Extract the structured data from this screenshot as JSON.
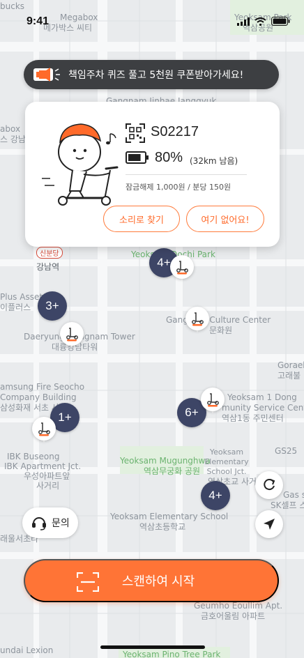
{
  "status_bar": {
    "time": "9:41"
  },
  "map": {
    "labels": [
      {
        "key": "bucks",
        "text": "bucks"
      },
      {
        "key": "megabox1",
        "text": "Megabox"
      },
      {
        "key": "megabox1_kr",
        "text": "메가박스 씨티"
      },
      {
        "key": "yeoksam_park",
        "text": "Yeoksam Park"
      },
      {
        "key": "yeoksam_park_kr",
        "text": "역삼공원"
      },
      {
        "key": "jinhae",
        "text": "Gangnam Jinhae Janggyuk"
      },
      {
        "key": "abox",
        "text": "abox"
      },
      {
        "key": "abox_kr",
        "text": "스 강남"
      },
      {
        "key": "ochi_park",
        "text": "Yeoksam-Dochi Park"
      },
      {
        "key": "gangnam_stn",
        "text": "강남역"
      },
      {
        "key": "plus_asset",
        "text": "Plus Asset"
      },
      {
        "key": "plus_asset_kr",
        "text": "이플러스"
      },
      {
        "key": "culture_center",
        "text": "Gangnam Culture Center"
      },
      {
        "key": "culture_center_kr",
        "text": "문화원"
      },
      {
        "key": "daeryung",
        "text": "Daeryung Gangnam Tower"
      },
      {
        "key": "daeryung_kr",
        "text": "대륭강남타워"
      },
      {
        "key": "goraebal",
        "text": "Goraeb"
      },
      {
        "key": "goraebal_kr",
        "text": "고래불"
      },
      {
        "key": "samsung",
        "text": "amsung Fire Seocho"
      },
      {
        "key": "samsung2",
        "text": "Company Building"
      },
      {
        "key": "samsung_kr",
        "text": "삼성화재 서초 사옥"
      },
      {
        "key": "yeoksam1",
        "text": "Yeoksam 1 Dong"
      },
      {
        "key": "yeoksam1b",
        "text": "munity Service Center"
      },
      {
        "key": "yeoksam1_kr",
        "text": "역삼1동 주민센터"
      },
      {
        "key": "gs25",
        "text": "GS25"
      },
      {
        "key": "ibk",
        "text": "IBK Buseong"
      },
      {
        "key": "ibk2",
        "text": "IBK Apartment Jct."
      },
      {
        "key": "ibk_kr",
        "text": "우성아파트앞"
      },
      {
        "key": "ibk_kr2",
        "text": "사거리"
      },
      {
        "key": "mugunghwa",
        "text": "Yeoksam Mugunghwa"
      },
      {
        "key": "mugunghwa_kr",
        "text": "역삼무궁화 공원"
      },
      {
        "key": "elem_jct",
        "text": "Yeoksam Elementary School Jct."
      },
      {
        "key": "elem_jct_kr",
        "text": "역삼초교 사거리"
      },
      {
        "key": "gas",
        "text": "Gas s"
      },
      {
        "key": "gas_kr",
        "text": "SK셀프 스"
      },
      {
        "key": "elem",
        "text": "Yeoksam Elementary School"
      },
      {
        "key": "elem_kr",
        "text": "역삼초등학교"
      },
      {
        "key": "seocho_kr",
        "text": "래울서초타"
      },
      {
        "key": "geumho",
        "text": "Geumho Eoullim Apt."
      },
      {
        "key": "geumho_kr",
        "text": "금호어울림 아파트"
      },
      {
        "key": "hyundai",
        "text": "undai Lexion"
      },
      {
        "key": "pino",
        "text": "Yeoksam Pino Tree Park"
      }
    ],
    "station_badge": "신분당"
  },
  "banner": {
    "text": "책임주차 퀴즈 풀고 5천원 쿠폰받아가세요!"
  },
  "card": {
    "scooter_id": "S02217",
    "battery": "80%",
    "battery_level": 0.8,
    "range": "(32km 남음)",
    "fee": "잠금해제 1,000원 / 분당 150원",
    "find_by_sound": "소리로 찾기",
    "not_here": "여기 없어요!"
  },
  "clusters": [
    "4+",
    "3+",
    "1+",
    "6+",
    "4+"
  ],
  "inquiry": {
    "label": "문의"
  },
  "scan_button": {
    "label": "스캔하여 시작"
  },
  "colors": {
    "accent": "#ff7436",
    "cluster": "#3d4566",
    "banner": "#3d3f42"
  }
}
